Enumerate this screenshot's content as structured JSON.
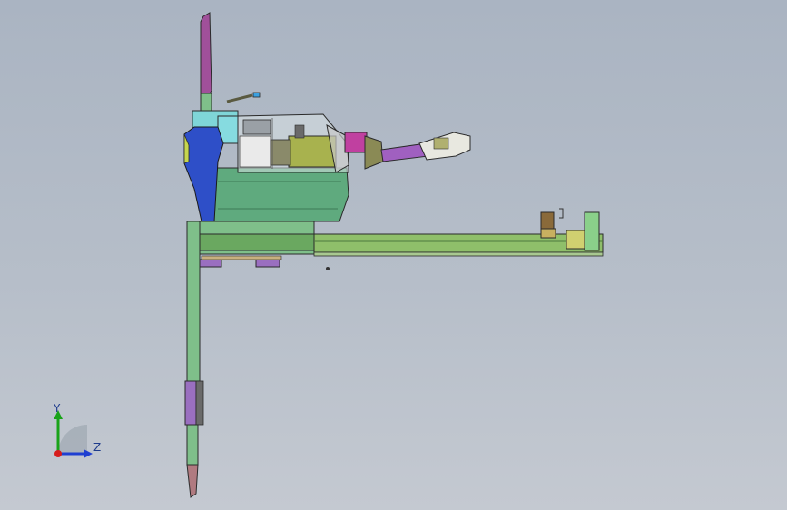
{
  "viewport": {
    "background_top": "#aab4c2",
    "background_bottom": "#c4c9d1"
  },
  "triad": {
    "y_label": "Y",
    "z_label": "Z",
    "y_color": "#19a319",
    "z_color": "#1f3fd1",
    "x_color": "#d61c1c"
  },
  "colors": {
    "frame_green": "#7fbf8a",
    "cover_green": "#5faa7e",
    "body_blue": "#2e4fc8",
    "housing_cyan": "#7fd6d8",
    "motor_olive": "#9aa84a",
    "arm_magenta": "#b04fa0",
    "bracket_purple": "#9a6fc0",
    "rail_green": "#8fbf6a",
    "dark_line": "#2a2a2a"
  },
  "icons": {
    "triad": "coordinate-triad-icon"
  }
}
